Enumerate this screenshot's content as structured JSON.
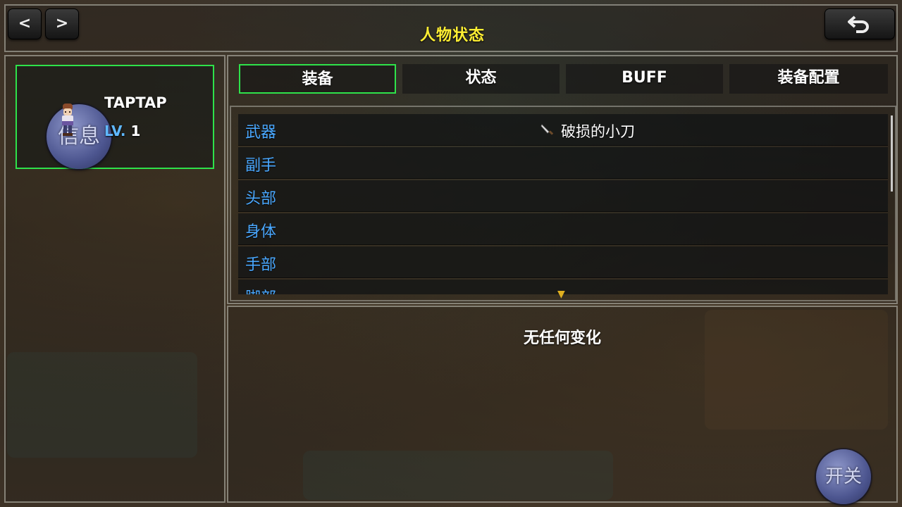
{
  "header": {
    "title": "人物状态",
    "prev_label": "<",
    "next_label": ">",
    "back_icon": "undo-arrow-icon"
  },
  "character": {
    "name": "TAPTAP",
    "level_prefix": "LV.",
    "level_value": "1",
    "info_button_label": "信息"
  },
  "tabs": [
    {
      "label": "装备",
      "active": true
    },
    {
      "label": "状态",
      "active": false
    },
    {
      "label": "BUFF",
      "active": false
    },
    {
      "label": "装备配置",
      "active": false
    }
  ],
  "equipment_slots": [
    {
      "slot": "武器",
      "item": "破损的小刀",
      "item_icon": "knife-icon"
    },
    {
      "slot": "副手",
      "item": ""
    },
    {
      "slot": "头部",
      "item": ""
    },
    {
      "slot": "身体",
      "item": ""
    },
    {
      "slot": "手部",
      "item": ""
    },
    {
      "slot": "脚部",
      "item": ""
    }
  ],
  "detail_panel": {
    "text": "无任何变化"
  },
  "toggle_button_label": "开关",
  "colors": {
    "title": "#ffef33",
    "active_border": "#2ee24a",
    "slot_label": "#4aa8ff",
    "level_label": "#5fb8ff"
  }
}
